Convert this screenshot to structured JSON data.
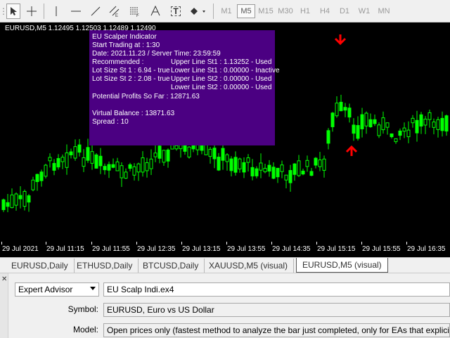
{
  "toolbar": {
    "tools": [
      "cursor-icon",
      "crosshair-icon",
      "vertical-line-icon",
      "horizontal-line-icon",
      "trendline-icon",
      "channel-icon",
      "fibonacci-icon",
      "text-icon",
      "text-label-icon",
      "shapes-icon"
    ],
    "text_tool": "A",
    "label_tool": "T",
    "timeframes": [
      "M1",
      "M5",
      "M15",
      "M30",
      "H1",
      "H4",
      "D1",
      "W1",
      "MN"
    ],
    "active_timeframe": "M5"
  },
  "chart": {
    "header": "EURUSD,M5  1.12495 1.12503 1.12489 1.12490",
    "background": "#000000",
    "bull_color": "#00ff00",
    "arrow_color": "#ff0000",
    "info": {
      "title": "EU Scalper Indicator",
      "start_trading": "Start Trading at : 1:30",
      "date": "Date: 2021.11.23 / Server Time: 23:59:59",
      "recommended": "Recommended :",
      "upper_st1": "Upper Line St1 : 1.13252 - Used",
      "lot_st1": "Lot Size St 1 : 6.94 - true",
      "lower_st1": "Lower Line St1 : 0.00000 - Inactive",
      "lot_st2": "Lot Size St 2 : 2.08 - true",
      "upper_st2": "Upper Line St2 : 0.00000 - Used",
      "lower_st2": "Lower Line St2 : 0.00000 - Used",
      "profits": "Potential Profits So Far :  12871.63",
      "virtual_balance": "Virtual Balance :  13871.63",
      "spread": "Spread : 10",
      "background": "#4b0082"
    },
    "time_labels": [
      "29 Jul 2021",
      "29 Jul 11:15",
      "29 Jul 11:55",
      "29 Jul 12:35",
      "29 Jul 13:15",
      "29 Jul 13:55",
      "29 Jul 14:35",
      "29 Jul 15:15",
      "29 Jul 15:55",
      "29 Jul 16:35"
    ]
  },
  "tabs": [
    {
      "label": "EURUSD,Daily"
    },
    {
      "label": "ETHUSD,Daily"
    },
    {
      "label": "BTCUSD,Daily"
    },
    {
      "label": "XAUUSD,M5 (visual)"
    },
    {
      "label": "EURUSD,M5 (visual)"
    }
  ],
  "active_tab": "EURUSD,M5 (visual)",
  "tester": {
    "close_icon": "close-icon",
    "mode": "Expert Advisor",
    "expert": "EU Scalp Indi.ex4",
    "symbol_label": "Symbol:",
    "symbol": "EURUSD, Euro vs US Dollar",
    "model_label": "Model:",
    "model": "Open prices only (fastest method to analyze the bar just completed, only for EAs that explicitly control bar opening)"
  }
}
